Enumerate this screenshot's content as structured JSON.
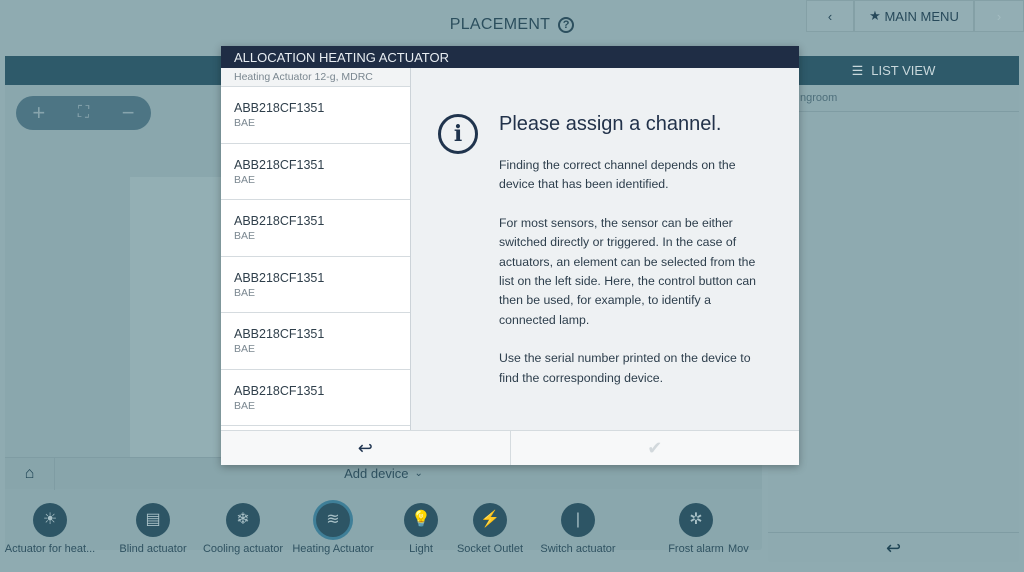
{
  "header": {
    "title": "PLACEMENT",
    "help_icon": "?",
    "back_label": "‹",
    "main_menu_label": "MAIN MENU",
    "forward_label": "›"
  },
  "right_panel": {
    "list_view_label": "LIST VIEW",
    "room_label": "ngroom"
  },
  "zoom_controls": {
    "zoom_in": "+",
    "fit": "⛶",
    "zoom_out": "−"
  },
  "add_device": {
    "label": "Add device"
  },
  "devices": [
    {
      "label": "Actuator for heat...",
      "icon": "☀"
    },
    {
      "label": "Blind actuator",
      "icon": "▤"
    },
    {
      "label": "Cooling actuator",
      "icon": "❄"
    },
    {
      "label": "Heating Actuator",
      "icon": "≋",
      "selected": true
    },
    {
      "label": "Light",
      "icon": "💡"
    },
    {
      "label": "Socket Outlet",
      "icon": "⚡"
    },
    {
      "label": "Switch actuator",
      "icon": "|"
    },
    {
      "label": "Frost alarm",
      "icon": "✲"
    },
    {
      "label": "Mov",
      "icon": ""
    }
  ],
  "dialog": {
    "title": "ALLOCATION HEATING ACTUATOR",
    "list_header": "Heating Actuator 12-g, MDRC",
    "items": [
      {
        "name": "ABB218CF1351",
        "sub": "BAE"
      },
      {
        "name": "ABB218CF1351",
        "sub": "BAE"
      },
      {
        "name": "ABB218CF1351",
        "sub": "BAE"
      },
      {
        "name": "ABB218CF1351",
        "sub": "BAE"
      },
      {
        "name": "ABB218CF1351",
        "sub": "BAE"
      },
      {
        "name": "ABB218CF1351",
        "sub": "BAE"
      }
    ],
    "heading": "Please assign a channel.",
    "paragraphs": [
      "Finding the correct channel depends on the device that has been identified.",
      "For most sensors, the sensor can be either switched directly or triggered. In the case of actuators, an element can be selected from the list on the left side. Here, the control button can then be used, for example, to identify a connected lamp.",
      "Use the serial number printed on the device to find the corresponding device."
    ],
    "back_icon": "↩",
    "confirm_icon": "✔"
  }
}
